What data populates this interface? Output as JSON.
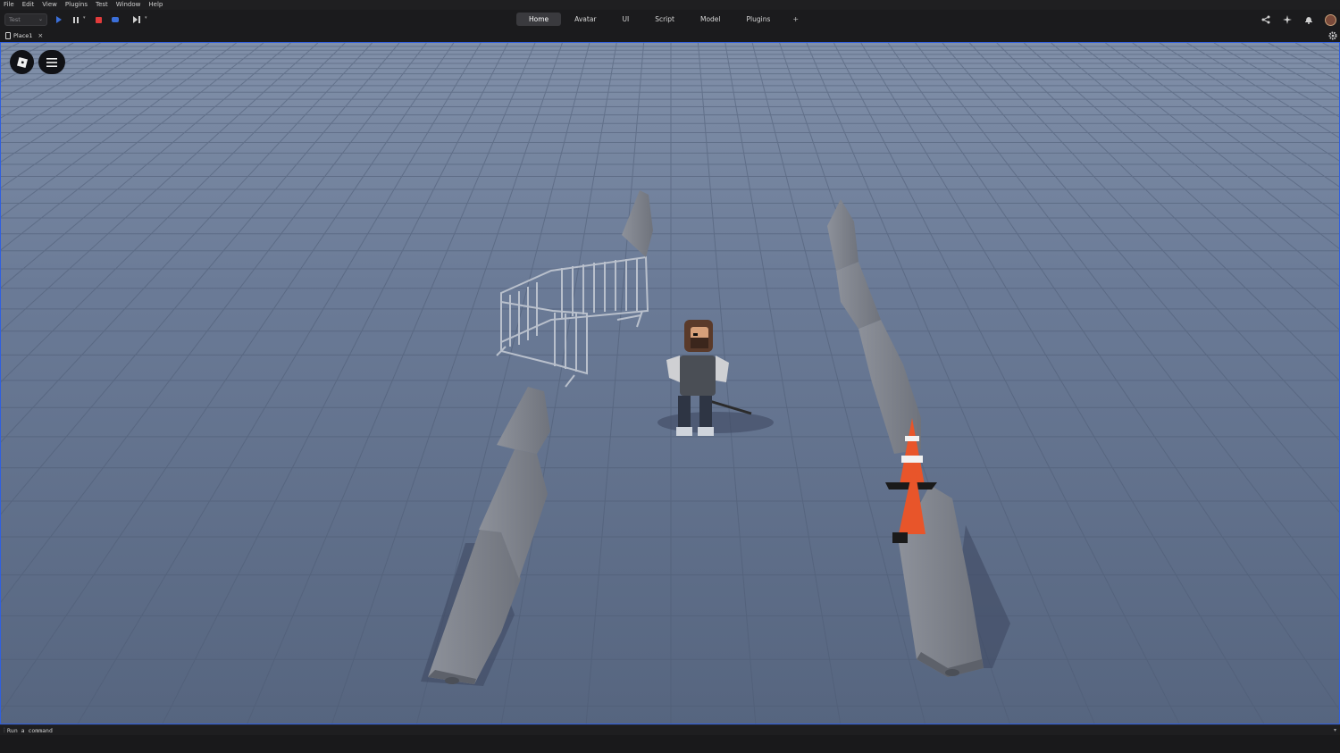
{
  "menubar": {
    "items": [
      "File",
      "Edit",
      "View",
      "Plugins",
      "Test",
      "Window",
      "Help"
    ]
  },
  "toolbar": {
    "mode_select": "Test",
    "icons": [
      "play-icon",
      "pause-icon",
      "stop-icon",
      "camera-icon",
      "step-icon"
    ]
  },
  "tabs": {
    "items": [
      "Home",
      "Avatar",
      "UI",
      "Script",
      "Model",
      "Plugins"
    ],
    "active": "Home",
    "add_label": "+"
  },
  "doc_tab": {
    "label": "Place1",
    "close": "×"
  },
  "command_bar": {
    "placeholder": "Run a command"
  },
  "colors": {
    "accent": "#2f5fe0",
    "stop": "#e23b3b",
    "play": "#3b6fd9",
    "floor": "#5f6e8a"
  }
}
